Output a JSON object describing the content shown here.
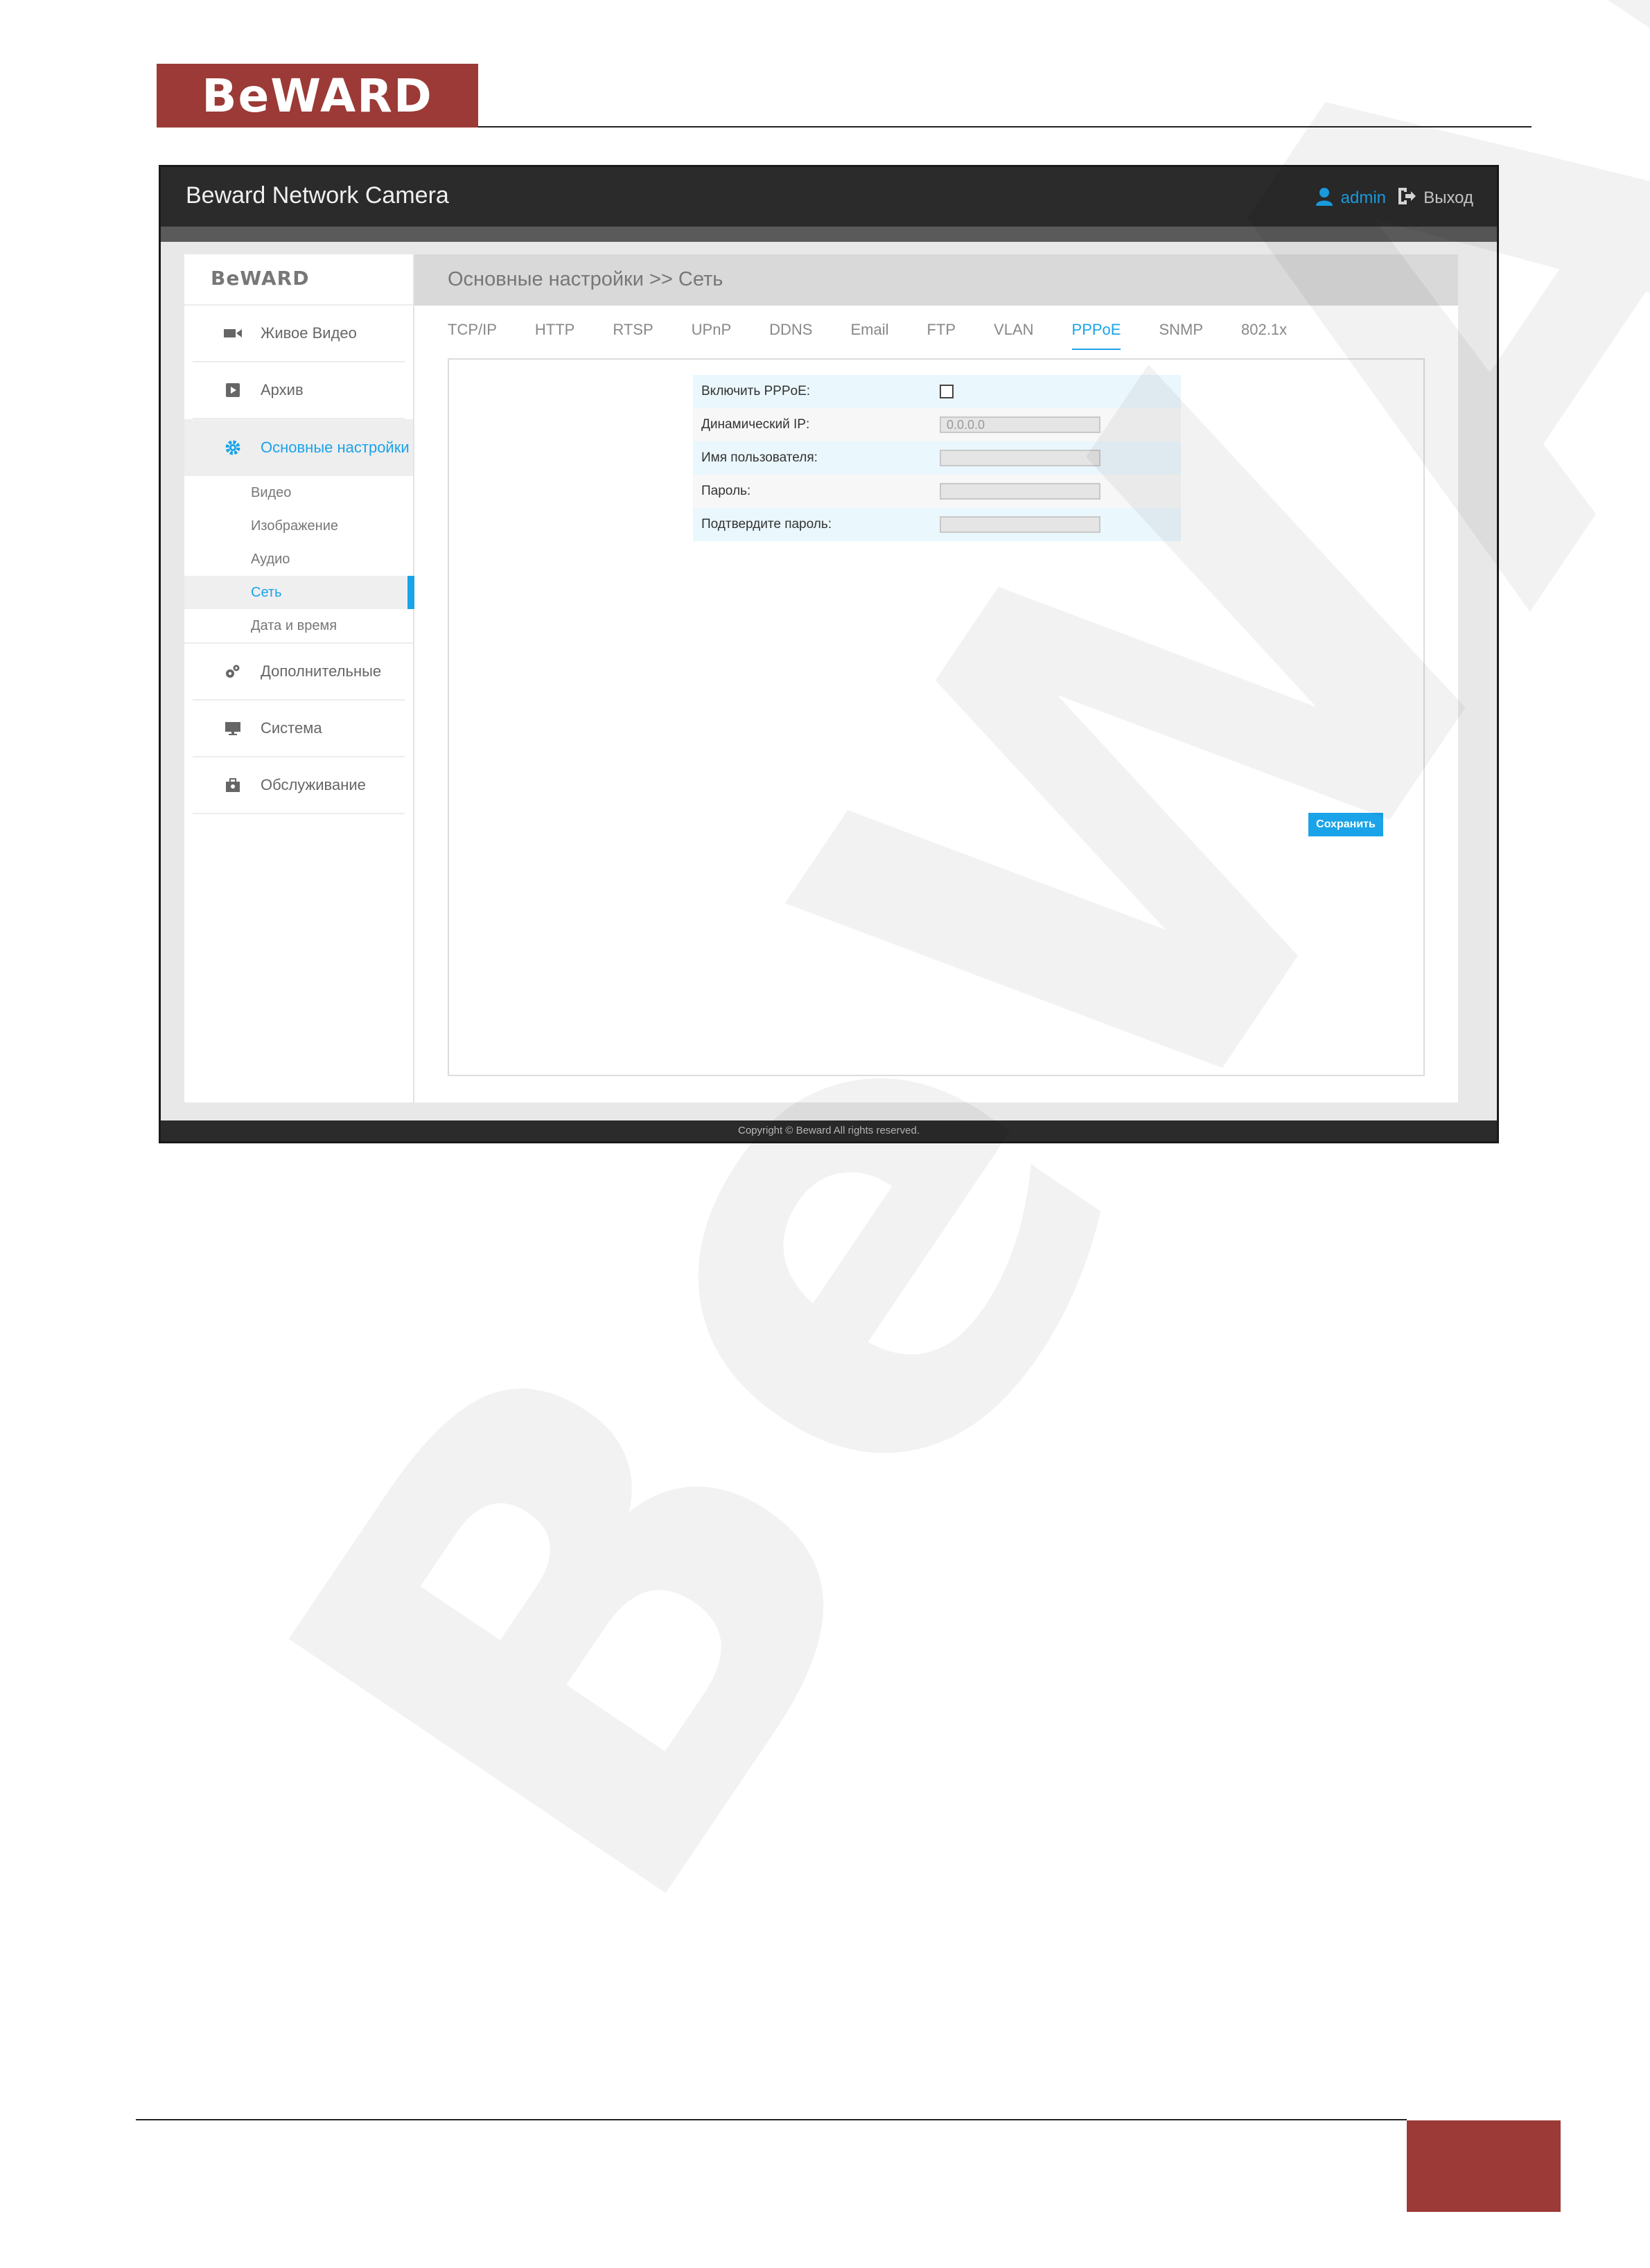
{
  "doc": {
    "logo_text": "BeWARD"
  },
  "app": {
    "title": "Beward Network Camera",
    "user": "admin",
    "logout": "Выход",
    "footer": "Copyright © Beward All rights reserved."
  },
  "sidebar": {
    "logo_text": "BeWARD",
    "items": [
      {
        "label": "Живое Видео",
        "icon": "video-camera-icon"
      },
      {
        "label": "Архив",
        "icon": "play-icon"
      },
      {
        "label": "Основные настройки",
        "icon": "gear-icon",
        "active": true
      },
      {
        "label": "Дополнительные",
        "icon": "gears-icon"
      },
      {
        "label": "Система",
        "icon": "monitor-icon"
      },
      {
        "label": "Обслуживание",
        "icon": "toolbox-icon"
      }
    ],
    "subitems": [
      {
        "label": "Видео"
      },
      {
        "label": "Изображение"
      },
      {
        "label": "Аудио"
      },
      {
        "label": "Сеть",
        "active": true
      },
      {
        "label": "Дата и время"
      }
    ]
  },
  "content": {
    "breadcrumb": "Основные настройки >> Сеть",
    "tabs": [
      "TCP/IP",
      "HTTP",
      "RTSP",
      "UPnP",
      "DDNS",
      "Email",
      "FTP",
      "VLAN",
      "PPPoE",
      "SNMP",
      "802.1x"
    ],
    "active_tab": "PPPoE"
  },
  "form": {
    "enable_label": "Включить PPPoE:",
    "enable_checked": false,
    "dynamic_ip_label": "Динамический IP:",
    "dynamic_ip_value": "0.0.0.0",
    "username_label": "Имя пользователя:",
    "username_value": "",
    "password_label": "Пароль:",
    "password_value": "",
    "confirm_label": "Подтвердите пароль:",
    "confirm_value": "",
    "save_label": "Сохранить"
  },
  "colors": {
    "brand": "#9b3a36",
    "accent": "#1aa3e8",
    "topbar": "#2b2b2b"
  }
}
